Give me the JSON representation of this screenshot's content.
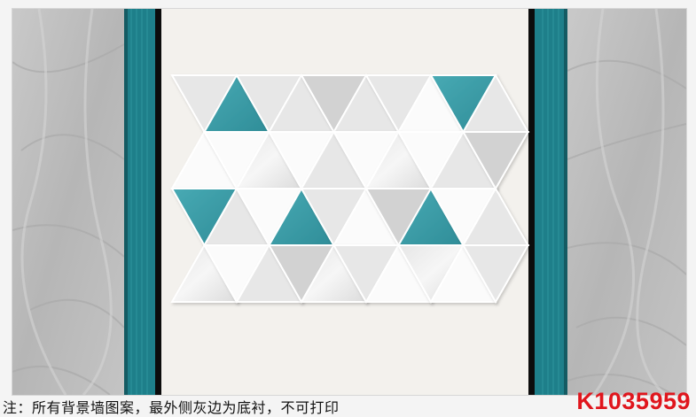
{
  "note": "注：所有背景墙图案，最外侧灰边为底衬，不可打印",
  "product_code": "K1035959",
  "colors": {
    "teal": "#2b8f99",
    "teal_light": "#5fb9c3",
    "marble_gray": "#bcbcbc",
    "panel": "#f3f1ed",
    "code_red": "#e0161d"
  }
}
